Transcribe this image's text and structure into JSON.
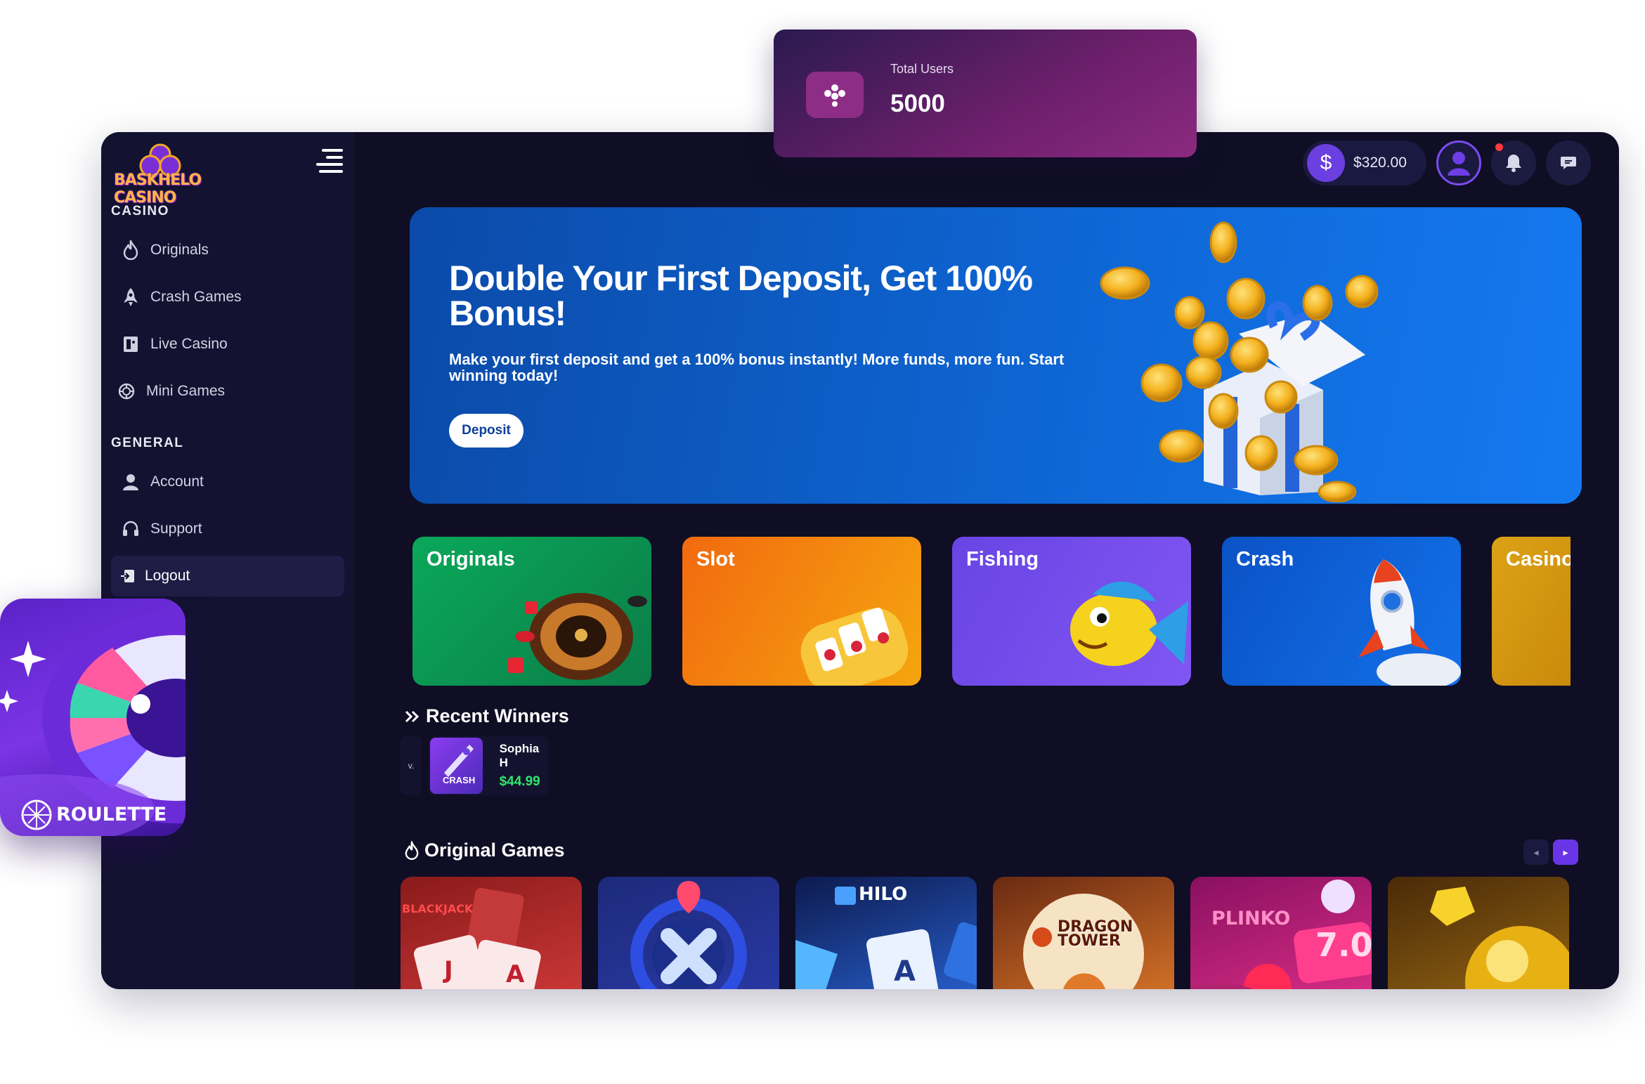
{
  "app": {
    "logo_text": "BASKHELO CASINO"
  },
  "sidebar": {
    "sections": [
      {
        "title": "CASINO",
        "items": [
          {
            "label": "Originals",
            "icon": "flame-icon"
          },
          {
            "label": "Crash Games",
            "icon": "rocket-icon"
          },
          {
            "label": "Live Casino",
            "icon": "cards-icon"
          },
          {
            "label": "Mini Games",
            "icon": "chip-icon"
          }
        ]
      },
      {
        "title": "GENERAL",
        "items": [
          {
            "label": "Account",
            "icon": "user-icon"
          },
          {
            "label": "Support",
            "icon": "headset-icon"
          },
          {
            "label": "Logout",
            "icon": "logout-icon",
            "active": true
          }
        ]
      }
    ]
  },
  "header": {
    "balance": "$320.00",
    "notification_dot": true
  },
  "stats": {
    "label": "Total Users",
    "value": "5000"
  },
  "banner": {
    "title": "Double Your First Deposit, Get 100% Bonus!",
    "subtitle": "Make your first deposit and get a 100% bonus instantly! More funds, more fun. Start winning today!",
    "button": "Deposit"
  },
  "categories": [
    {
      "label": "Originals",
      "color_from": "#0aa85a",
      "color_to": "#0b7d48"
    },
    {
      "label": "Slot",
      "color_from": "#f26d0f",
      "color_to": "#f4a40e"
    },
    {
      "label": "Fishing",
      "color_from": "#6a46e6",
      "color_to": "#7d58f0"
    },
    {
      "label": "Crash",
      "color_from": "#0c55c9",
      "color_to": "#1273ea"
    },
    {
      "label": "Casino",
      "color_from": "#d79b12",
      "color_to": "#c98a0a"
    }
  ],
  "recent_winners": {
    "title": "Recent Winners",
    "partial_label": "v.",
    "items": [
      {
        "name": "Sophia H",
        "amount": "$44.99",
        "game": "CRASH"
      }
    ]
  },
  "original_games": {
    "title": "Original Games",
    "tiles": [
      {
        "name": "BLACKJACK"
      },
      {
        "name": ""
      },
      {
        "name": "HILO"
      },
      {
        "name": "DRAGON TOWER"
      },
      {
        "name": "PLINKO",
        "badge": "7.0"
      },
      {
        "name": ""
      }
    ]
  },
  "roulette_card": {
    "label": "ROULETTE"
  }
}
